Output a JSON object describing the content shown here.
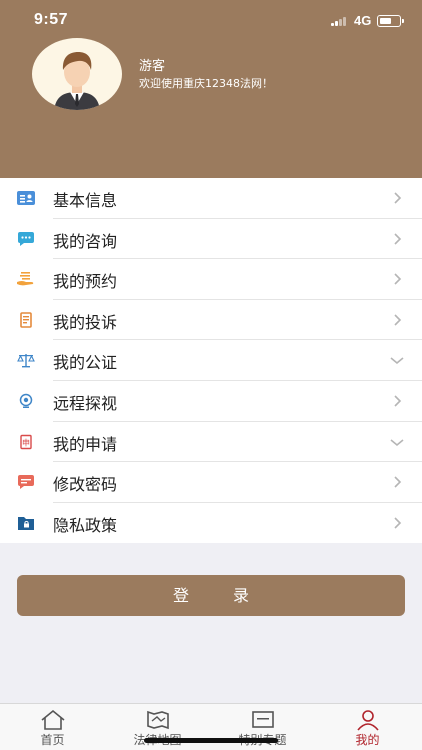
{
  "status_bar": {
    "time": "9:57",
    "network": "4G",
    "battery_level": 0.65
  },
  "profile": {
    "username": "游客",
    "welcome": "欢迎使用重庆12348法网！"
  },
  "menu": [
    {
      "label": "基本信息",
      "icon": "id-card-icon",
      "color": "#4a8fd9",
      "chevron": "right"
    },
    {
      "label": "我的咨询",
      "icon": "chat-bubble-icon",
      "color": "#35a8d8",
      "chevron": "right"
    },
    {
      "label": "我的预约",
      "icon": "hand-list-icon",
      "color": "#f2a23c",
      "chevron": "right"
    },
    {
      "label": "我的投诉",
      "icon": "complaint-doc-icon",
      "color": "#e48a3c",
      "chevron": "right"
    },
    {
      "label": "我的公证",
      "icon": "scales-icon",
      "color": "#3f86c8",
      "chevron": "down"
    },
    {
      "label": "远程探视",
      "icon": "webcam-icon",
      "color": "#3f86c8",
      "chevron": "right"
    },
    {
      "label": "我的申请",
      "icon": "application-doc-icon",
      "color": "#d94a4a",
      "chevron": "down"
    },
    {
      "label": "修改密码",
      "icon": "password-bubble-icon",
      "color": "#e86a5a",
      "chevron": "right"
    },
    {
      "label": "隐私政策",
      "icon": "privacy-folder-icon",
      "color": "#1f5f96",
      "chevron": "right"
    }
  ],
  "login_button": "登录",
  "tabs": [
    {
      "label": "首页",
      "icon": "home-icon",
      "active": false
    },
    {
      "label": "法律地图",
      "icon": "map-icon",
      "active": false
    },
    {
      "label": "特别专题",
      "icon": "topic-icon",
      "active": false
    },
    {
      "label": "我的",
      "icon": "person-icon",
      "active": true
    }
  ],
  "colors": {
    "brand": "#9b7b5e",
    "active_tab": "#b0242c",
    "background": "#efeff4"
  }
}
